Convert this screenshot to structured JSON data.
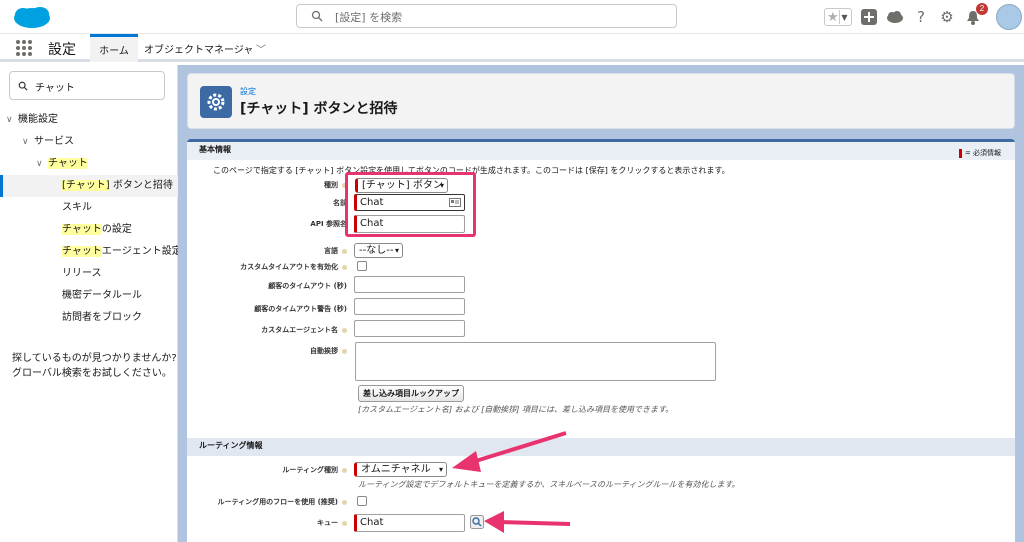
{
  "header": {
    "search_placeholder": "[設定] を検索",
    "notification_count": "2"
  },
  "nav": {
    "app_name": "設定",
    "tabs": [
      {
        "label": "ホーム"
      },
      {
        "label": "オブジェクトマネージャ"
      }
    ]
  },
  "sidebar": {
    "search_value": "チャット",
    "items": [
      {
        "label": "機能設定"
      },
      {
        "label": "サービス"
      },
      {
        "label": "チャット"
      },
      {
        "label_hl": "[チャット]",
        "label_rest": " ボタンと招待"
      },
      {
        "label": "スキル"
      },
      {
        "label_hl": "チャット",
        "label_rest": "の設定"
      },
      {
        "label_hl": "チャット",
        "label_rest": "エージェント設定"
      },
      {
        "label": "リリース"
      },
      {
        "label": "機密データルール"
      },
      {
        "label": "訪問者をブロック"
      }
    ],
    "help_line1": "探しているものが見つかりませんか?",
    "help_line2": "グローバル検索をお試しください。"
  },
  "page": {
    "breadcrumb": "設定",
    "title": "[チャット] ボタンと招待"
  },
  "form": {
    "basic_header": "基本情報",
    "required_legend": "= 必須情報",
    "description": "このページで指定する [チャット] ボタン設定を使用してボタンのコードが生成されます。このコードは [保存] をクリックすると表示されます。",
    "type_label": "種別",
    "type_value": "[チャット] ボタン",
    "name_label": "名前",
    "name_value": "Chat",
    "api_label": "API 参照名",
    "api_value": "Chat",
    "language_label": "言語",
    "language_value": "--なし--",
    "custom_timeout_label": "カスタムタイムアウトを有効化",
    "customer_timeout_label": "顧客のタイムアウト (秒)",
    "customer_timeout_warn_label": "顧客のタイムアウト警告 (秒)",
    "custom_agent_label": "カスタムエージェント名",
    "auto_greeting_label": "自動挨拶",
    "merge_button": "差し込み項目ルックアップ",
    "merge_hint": "[カスタムエージェント名] および [自動挨拶] 項目には、差し込み項目を使用できます。",
    "routing_header": "ルーティング情報",
    "routing_type_label": "ルーティング種別",
    "routing_type_value": "オムニチャネル",
    "routing_hint": "ルーティング設定でデフォルトキューを定義するか、スキルベースのルーティングルールを有効化します。",
    "flow_label": "ルーティング用のフローを使用 (推奨)",
    "queue_label": "キュー",
    "queue_value": "Chat"
  },
  "colors": {
    "brand_blue": "#0176d3",
    "required_red": "#cc0000",
    "annotation_pink": "#e8336e",
    "main_bg": "#b0c4df"
  }
}
